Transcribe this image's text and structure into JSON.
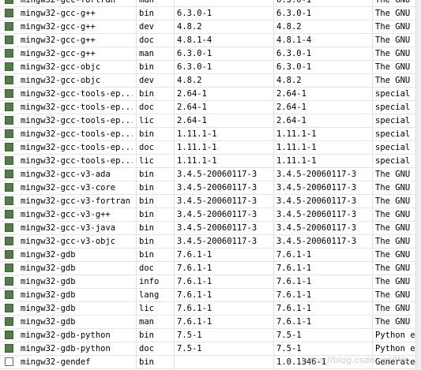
{
  "packages": [
    {
      "checked": true,
      "name": "mingw32-gcc-fortran",
      "class": "man",
      "installed": "",
      "repository": "6.3.0-1",
      "description": "The GNU FO"
    },
    {
      "checked": true,
      "name": "mingw32-gcc-g++",
      "class": "bin",
      "installed": "6.3.0-1",
      "repository": "6.3.0-1",
      "description": "The GNU C+"
    },
    {
      "checked": true,
      "name": "mingw32-gcc-g++",
      "class": "dev",
      "installed": "4.8.2",
      "repository": "4.8.2",
      "description": "The GNU C+"
    },
    {
      "checked": true,
      "name": "mingw32-gcc-g++",
      "class": "doc",
      "installed": "4.8.1-4",
      "repository": "4.8.1-4",
      "description": "The GNU C+"
    },
    {
      "checked": true,
      "name": "mingw32-gcc-g++",
      "class": "man",
      "installed": "6.3.0-1",
      "repository": "6.3.0-1",
      "description": "The GNU C+"
    },
    {
      "checked": true,
      "name": "mingw32-gcc-objc",
      "class": "bin",
      "installed": "6.3.0-1",
      "repository": "6.3.0-1",
      "description": "The GNU Ob"
    },
    {
      "checked": true,
      "name": "mingw32-gcc-objc",
      "class": "dev",
      "installed": "4.8.2",
      "repository": "4.8.2",
      "description": "The GNU Ob"
    },
    {
      "checked": true,
      "name": "mingw32-gcc-tools-ep...",
      "class": "bin",
      "installed": "2.64-1",
      "repository": "2.64-1",
      "description": "special au"
    },
    {
      "checked": true,
      "name": "mingw32-gcc-tools-ep...",
      "class": "doc",
      "installed": "2.64-1",
      "repository": "2.64-1",
      "description": "special au"
    },
    {
      "checked": true,
      "name": "mingw32-gcc-tools-ep...",
      "class": "lic",
      "installed": "2.64-1",
      "repository": "2.64-1",
      "description": "special au"
    },
    {
      "checked": true,
      "name": "mingw32-gcc-tools-ep...",
      "class": "bin",
      "installed": "1.11.1-1",
      "repository": "1.11.1-1",
      "description": "special au"
    },
    {
      "checked": true,
      "name": "mingw32-gcc-tools-ep...",
      "class": "doc",
      "installed": "1.11.1-1",
      "repository": "1.11.1-1",
      "description": "special au"
    },
    {
      "checked": true,
      "name": "mingw32-gcc-tools-ep...",
      "class": "lic",
      "installed": "1.11.1-1",
      "repository": "1.11.1-1",
      "description": "special au"
    },
    {
      "checked": true,
      "name": "mingw32-gcc-v3-ada",
      "class": "bin",
      "installed": "3.4.5-20060117-3",
      "repository": "3.4.5-20060117-3",
      "description": "The GNU Ad"
    },
    {
      "checked": true,
      "name": "mingw32-gcc-v3-core",
      "class": "bin",
      "installed": "3.4.5-20060117-3",
      "repository": "3.4.5-20060117-3",
      "description": "The GNU C"
    },
    {
      "checked": true,
      "name": "mingw32-gcc-v3-fortran",
      "class": "bin",
      "installed": "3.4.5-20060117-3",
      "repository": "3.4.5-20060117-3",
      "description": "The GNU FO"
    },
    {
      "checked": true,
      "name": "mingw32-gcc-v3-g++",
      "class": "bin",
      "installed": "3.4.5-20060117-3",
      "repository": "3.4.5-20060117-3",
      "description": "The GNU C+"
    },
    {
      "checked": true,
      "name": "mingw32-gcc-v3-java",
      "class": "bin",
      "installed": "3.4.5-20060117-3",
      "repository": "3.4.5-20060117-3",
      "description": "The GNU Ja"
    },
    {
      "checked": true,
      "name": "mingw32-gcc-v3-objc",
      "class": "bin",
      "installed": "3.4.5-20060117-3",
      "repository": "3.4.5-20060117-3",
      "description": "The GNU Ob"
    },
    {
      "checked": true,
      "name": "mingw32-gdb",
      "class": "bin",
      "installed": "7.6.1-1",
      "repository": "7.6.1-1",
      "description": "The GNU So"
    },
    {
      "checked": true,
      "name": "mingw32-gdb",
      "class": "doc",
      "installed": "7.6.1-1",
      "repository": "7.6.1-1",
      "description": "The GNU So"
    },
    {
      "checked": true,
      "name": "mingw32-gdb",
      "class": "info",
      "installed": "7.6.1-1",
      "repository": "7.6.1-1",
      "description": "The GNU So"
    },
    {
      "checked": true,
      "name": "mingw32-gdb",
      "class": "lang",
      "installed": "7.6.1-1",
      "repository": "7.6.1-1",
      "description": "The GNU So"
    },
    {
      "checked": true,
      "name": "mingw32-gdb",
      "class": "lic",
      "installed": "7.6.1-1",
      "repository": "7.6.1-1",
      "description": "The GNU So"
    },
    {
      "checked": true,
      "name": "mingw32-gdb",
      "class": "man",
      "installed": "7.6.1-1",
      "repository": "7.6.1-1",
      "description": "The GNU So"
    },
    {
      "checked": true,
      "name": "mingw32-gdb-python",
      "class": "bin",
      "installed": "7.5-1",
      "repository": "7.5-1",
      "description": "Python ena"
    },
    {
      "checked": true,
      "name": "mingw32-gdb-python",
      "class": "doc",
      "installed": "7.5-1",
      "repository": "7.5-1",
      "description": "Python ena"
    },
    {
      "checked": false,
      "name": "mingw32-gendef",
      "class": "bin",
      "installed": "",
      "repository": "1.0.1346-1",
      "description": "Generate ."
    }
  ],
  "colors": {
    "installed_checkbox": "#4f7f45",
    "empty_checkbox": "#ffffff"
  },
  "watermark": "https://blog.csdn.net/Wo..."
}
